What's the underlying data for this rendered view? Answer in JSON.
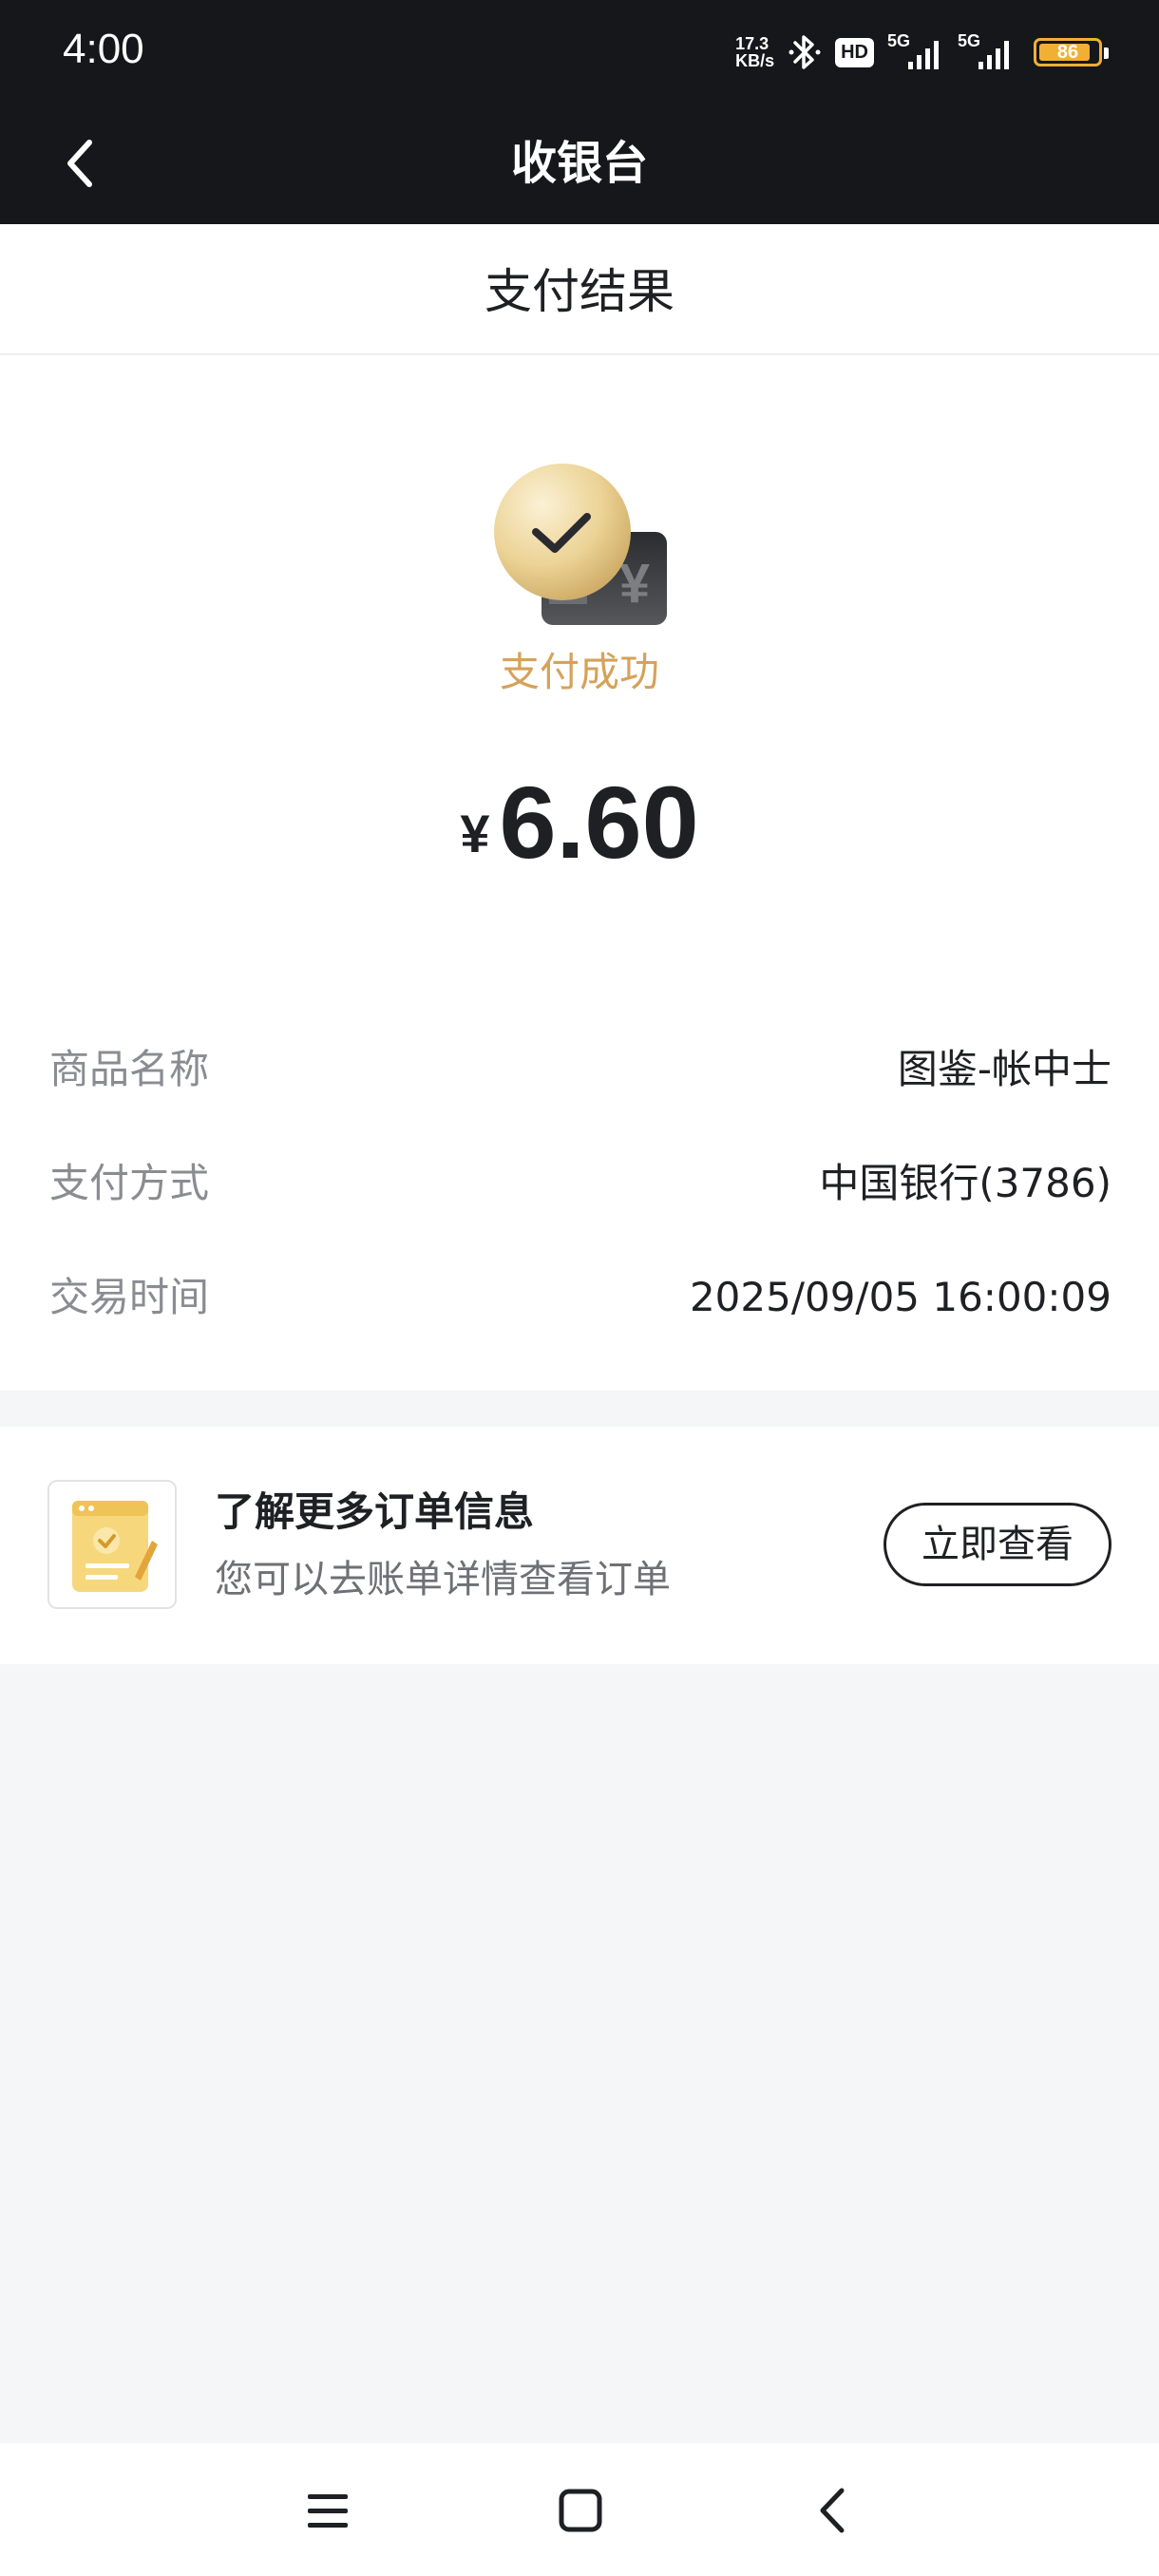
{
  "status_bar": {
    "time": "4:00",
    "net_speed_value": "17.3",
    "net_speed_unit": "KB/s",
    "hd_label": "HD",
    "signal_1_label": "5G",
    "signal_2_label": "5G",
    "battery_level": "86",
    "battery_color": "#f0b034"
  },
  "nav": {
    "back_icon": "chevron-left-icon",
    "title": "收银台"
  },
  "result": {
    "header": "支付结果",
    "status_icon": "payment-success-icon",
    "status_text": "支付成功",
    "status_color": "#d5a25a",
    "currency_symbol": "¥",
    "amount": "6.60"
  },
  "details": [
    {
      "label": "商品名称",
      "value": "图鉴-帐中士"
    },
    {
      "label": "支付方式",
      "value": "中国银行(3786)"
    },
    {
      "label": "交易时间",
      "value": "2025/09/05 16:00:09"
    }
  ],
  "order_card": {
    "icon": "order-document-icon",
    "title": "了解更多订单信息",
    "subtitle": "您可以去账单详情查看订单",
    "button_label": "立即查看"
  },
  "system_nav": {
    "menu_icon": "menu-icon",
    "home_icon": "home-icon",
    "back_icon": "back-icon"
  }
}
